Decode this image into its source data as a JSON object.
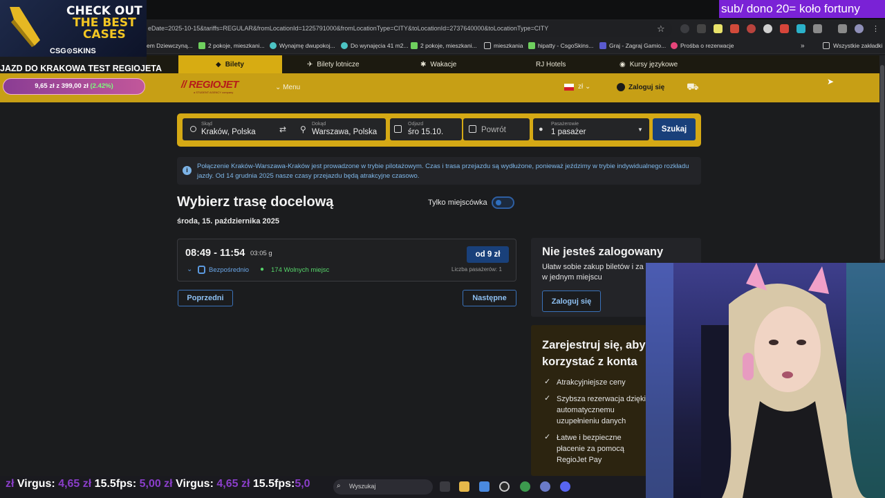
{
  "stream": {
    "ad_line1": "CHECK OUT",
    "ad_line2": "THE BEST",
    "ad_line3": "CASES",
    "ad_brand": "CSG⊙SKINS",
    "title": "JAZD DO KRAKOWA TEST REGIOJETA",
    "goal_current": "9,65 zł",
    "goal_sep": "z",
    "goal_target": "399,00 zł",
    "goal_percent": "(2.42%)",
    "sub_text": "sub/ dono 20= koło fortuny",
    "ticker_a": "zł",
    "ticker_name1": "Virgus:",
    "ticker_amount1": "4,65 zł",
    "ticker_name2": "15.5fps:",
    "ticker_amount2": "5,00 zł",
    "ticker_name3": "Virgus:",
    "ticker_amount3": "4,65 zł",
    "ticker_name4": "15.5fps:",
    "ticker_amount4": "5,0"
  },
  "browser": {
    "url": "eDate=2025-10-15&tariffs=REGULAR&fromLocationId=1225791000&fromLocationType=CITY&toLocationId=2737640000&toLocationType=CITY",
    "bookmarks": [
      "em Dziewczyną...",
      "2 pokoje, mieszkani...",
      "Wynajmę dwupokoj...",
      "Do wynajęcia 41 m2...",
      "2 pokoje, mieszkani...",
      "mieszkania",
      "hipatty - CsgoSkins...",
      "Graj - Zagraj Gamio...",
      "Prośba o rezerwacje"
    ],
    "bookmarks_all": "Wszystkie zakładki",
    "taskbar_search": "Wyszukaj"
  },
  "site": {
    "tabs": [
      "Bilety",
      "Bilety lotnicze",
      "Wakacje",
      "RJ Hotels",
      "Kursy językowe"
    ],
    "logo": "REGIOJET",
    "logo_sub": "a STUDENT AGENCY company",
    "menu": "Menu",
    "currency": "zł",
    "login": "Zaloguj się"
  },
  "search": {
    "from_label": "Skąd",
    "from_value": "Kraków, Polska",
    "to_label": "Dokąd",
    "to_value": "Warszawa, Polska",
    "depart_label": "Odjazd",
    "depart_value": "śro 15.10.",
    "return_placeholder": "Powrót",
    "pax_label": "Pasażerowie",
    "pax_value": "1 pasażer",
    "button": "Szukaj"
  },
  "notice": "Połączenie Kraków-Warszawa-Kraków jest prowadzone w trybie pilotażowym. Czas i trasa przejazdu są wydłużone, ponieważ jeździmy w trybie indywidualnego rozkładu jazdy. Od 14 grudnia 2025 nasze czasy przejazdu będą atrakcyjne czasowo.",
  "results": {
    "heading": "Wybierz trasę docelową",
    "date": "środa, 15. października 2025",
    "toggle_label": "Tylko miejscówka",
    "connection": {
      "time": "08:49 - 11:54",
      "duration": "03:05 g",
      "type": "Bezpośrednio",
      "seats": "174 Wolnych miejsc",
      "price": "od 9 zł",
      "pax_count": "Liczba pasażerów: 1"
    },
    "prev": "Poprzedni",
    "next": "Następne"
  },
  "side": {
    "login_title": "Nie jesteś zalogowany",
    "login_desc": "Ułatw sobie zakup biletów i za w jednym miejscu",
    "login_button": "Zaloguj się",
    "register_title": "Zarejestruj się, aby korzystać z konta",
    "benefits": [
      "Atrakcyjniejsze ceny",
      "Szybsza rezerwacja dzięki automatycznemu uzupełnieniu danych",
      "Łatwe i bezpieczne płacenie za pomocą RegioJet Pay"
    ]
  }
}
